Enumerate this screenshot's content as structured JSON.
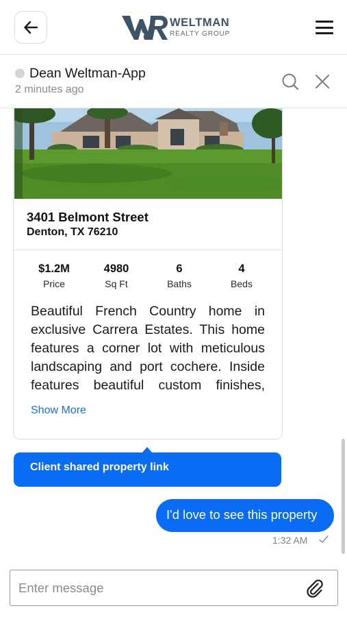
{
  "header": {
    "logo": {
      "initials": "WR",
      "name": "WELTMAN",
      "subtitle": "REALTY GROUP"
    },
    "icons": {
      "back": "back-arrow-icon",
      "menu": "hamburger-menu-icon"
    }
  },
  "chat": {
    "contact_name": "Dean Weltman-App",
    "last_seen": "2 minutes ago",
    "status": "offline",
    "icons": {
      "search": "search-icon",
      "close": "close-icon"
    }
  },
  "property_card": {
    "address": "3401 Belmont Street",
    "city": "Denton, TX 76210",
    "stats": [
      {
        "value": "$1.2M",
        "label": "Price"
      },
      {
        "value": "4980",
        "label": "Sq Ft"
      },
      {
        "value": "6",
        "label": "Baths"
      },
      {
        "value": "4",
        "label": "Beds"
      }
    ],
    "description": "Beautiful French Country home in exclusive Carrera Estates. This home features a corner lot with meticulous landscaping and port cochere. Inside features beautiful custom finishes,",
    "show_more": "Show More"
  },
  "shared_banner": "Client shared property link",
  "outgoing_message": {
    "text": "I'd love to see this property",
    "time": "1:32 AM",
    "status_icon": "check-icon"
  },
  "composer": {
    "placeholder": "Enter message",
    "attach_icon": "paperclip-icon"
  },
  "colors": {
    "accent": "#0a6cf5",
    "link": "#1b6fe0",
    "logo": "#3d5468"
  }
}
